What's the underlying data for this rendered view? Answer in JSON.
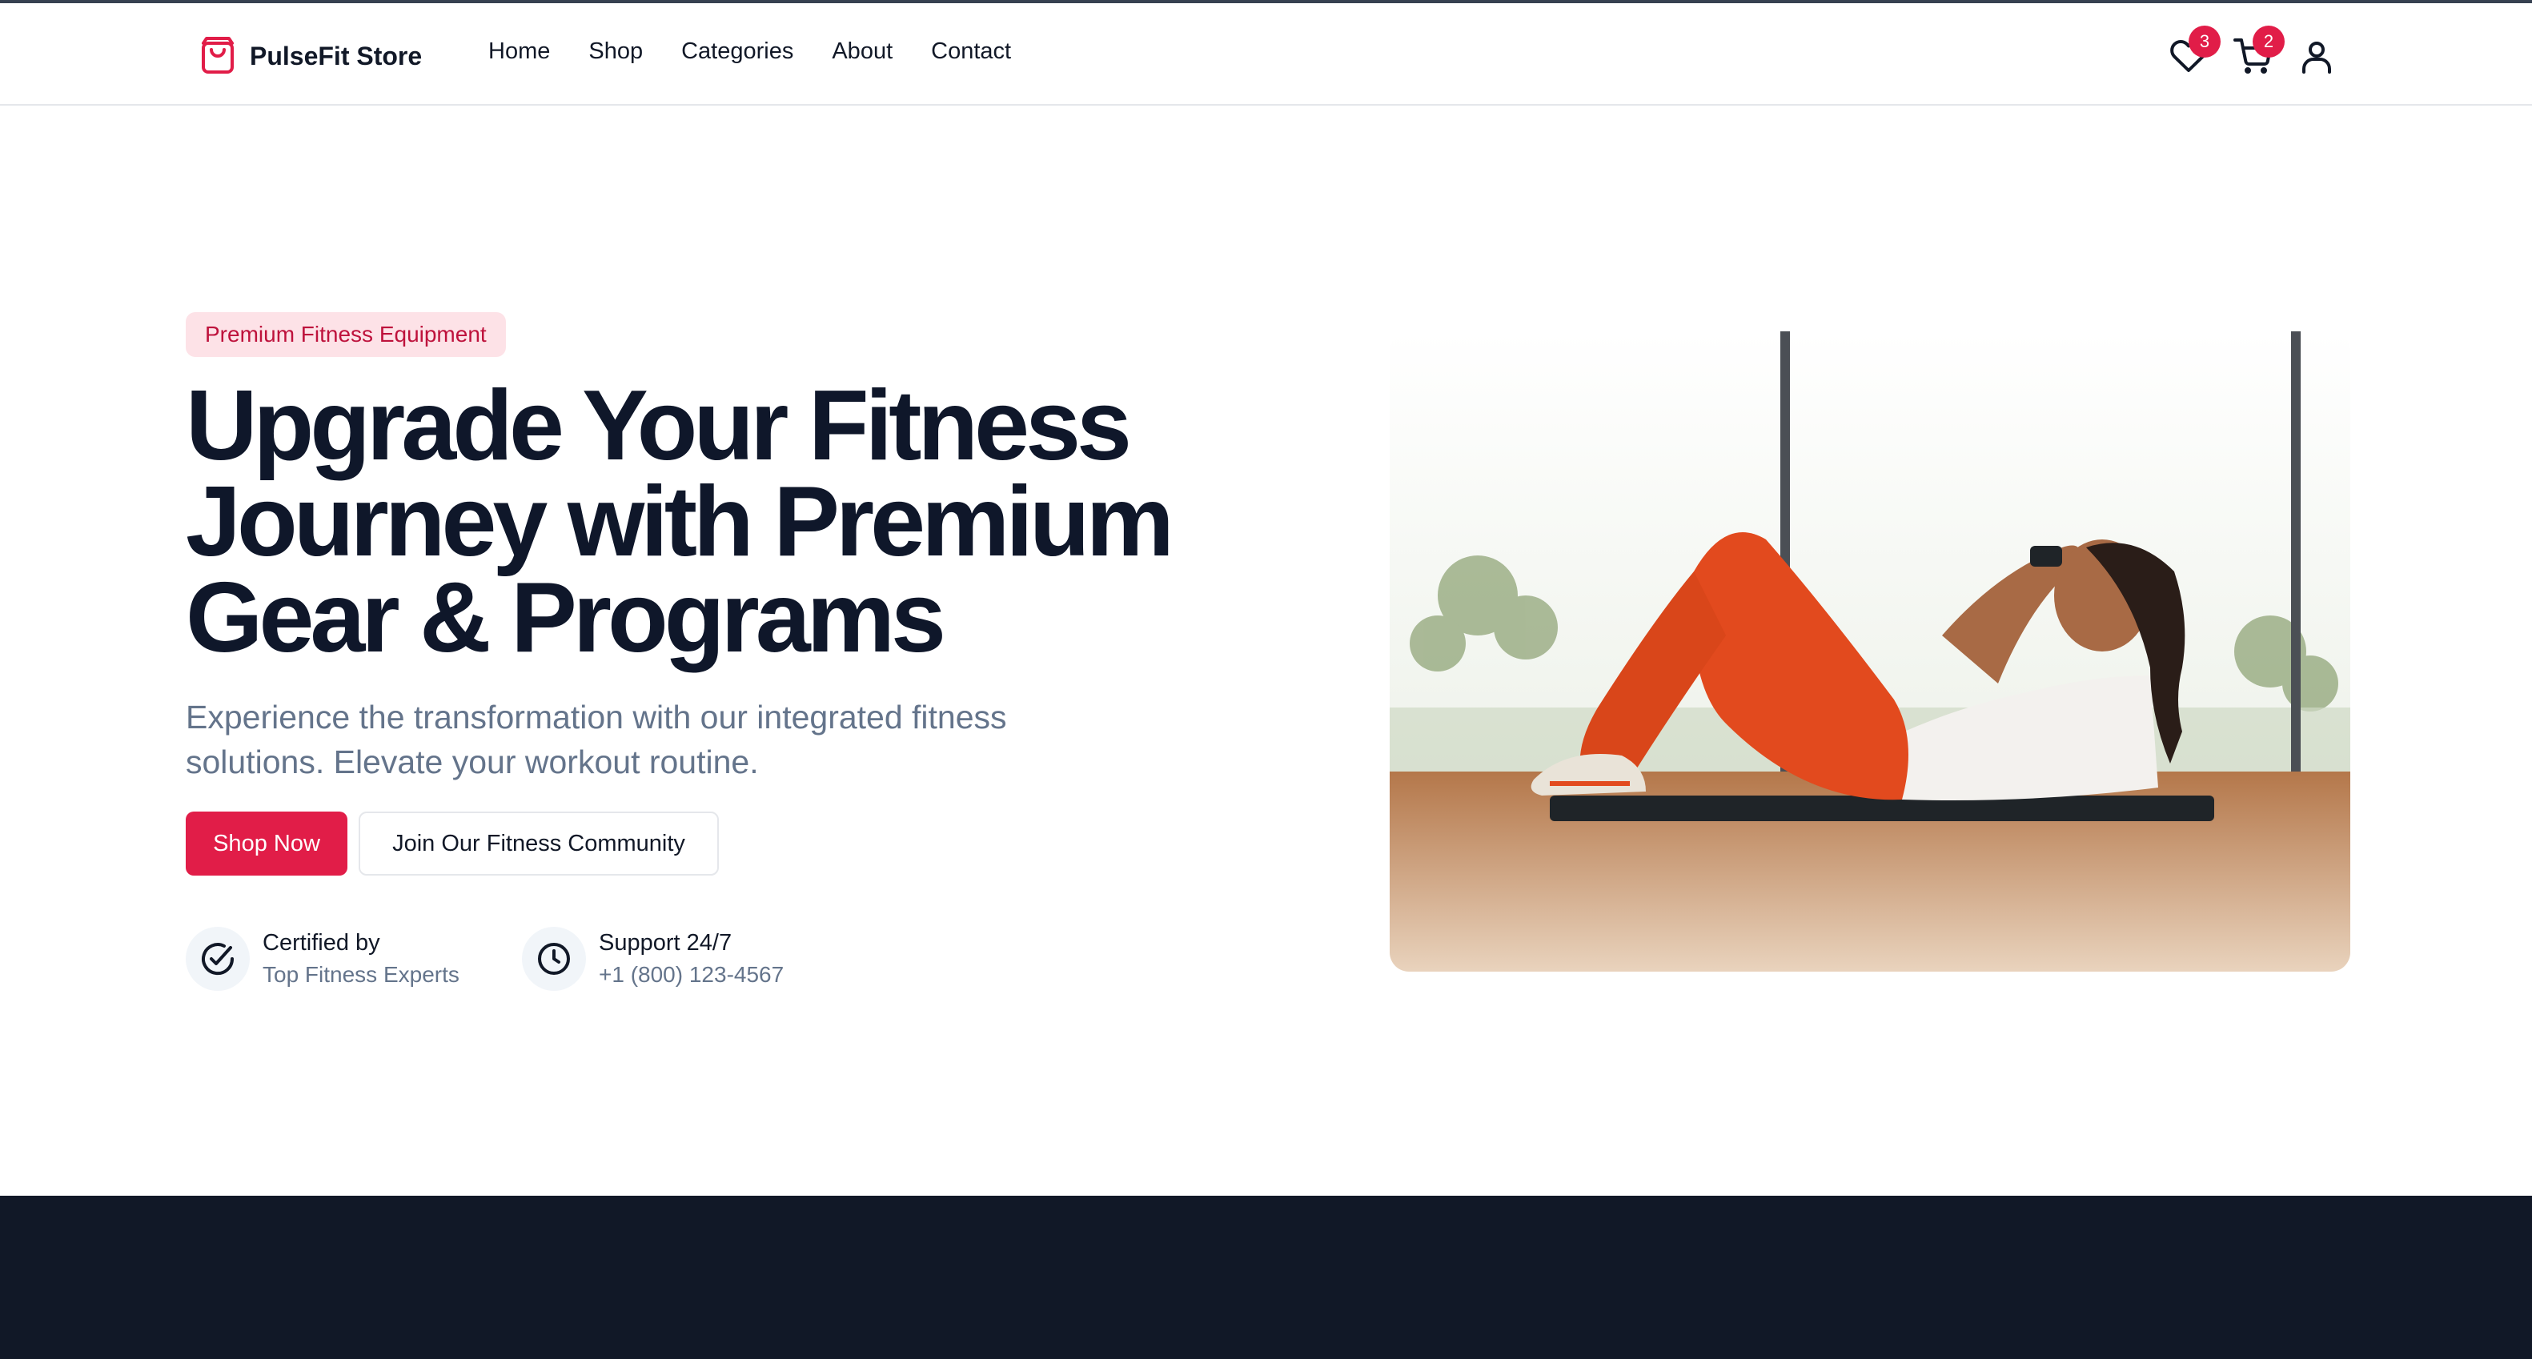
{
  "header": {
    "brand": "PulseFit Store",
    "nav": [
      "Home",
      "Shop",
      "Categories",
      "About",
      "Contact"
    ],
    "wishlist_count": "3",
    "cart_count": "2"
  },
  "hero": {
    "badge": "Premium Fitness Equipment",
    "title": "Upgrade Your Fitness Journey with Premium Gear & Programs",
    "subtitle": "Experience the transformation with our integrated fitness solutions. Elevate your workout routine.",
    "primary_cta": "Shop Now",
    "secondary_cta": "Join Our Fitness Community",
    "trust": [
      {
        "title": "Certified by",
        "detail": "Top Fitness Experts",
        "icon": "check-circle-icon"
      },
      {
        "title": "Support 24/7",
        "detail": "+1 (800) 123-4567",
        "icon": "clock-icon"
      }
    ]
  },
  "colors": {
    "accent": "#e11d48",
    "dark": "#111827",
    "muted": "#64748b"
  }
}
